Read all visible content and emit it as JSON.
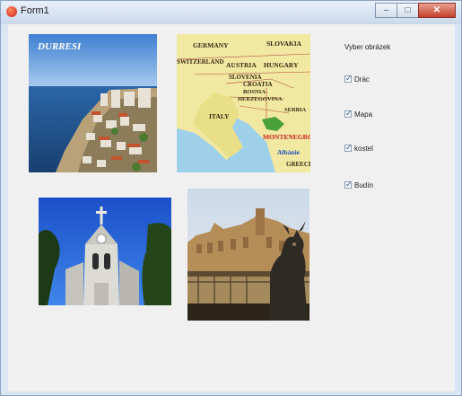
{
  "window": {
    "title": "Form1"
  },
  "caption_buttons": {
    "minimize": "–",
    "maximize": "□",
    "close": "✕"
  },
  "images": {
    "durresi": {
      "caption": "DURRESI"
    },
    "mapa": {
      "labels": [
        "GERMANY",
        "SLOVAKIA",
        "SWITZERLAND",
        "AUSTRIA",
        "HUNGARY",
        "SLOVENIA",
        "CROATIA",
        "BOSNIA-",
        "HERZEGOVINA",
        "ITALY",
        "SERBIA",
        "MONTENEGRO",
        "Albánie",
        "GREECE"
      ]
    }
  },
  "panel": {
    "prompt": "Vyber obrázek",
    "options": [
      {
        "label": "Drác",
        "checked": true
      },
      {
        "label": "Mapa",
        "checked": true
      },
      {
        "label": "kostel",
        "checked": true
      },
      {
        "label": "Budín",
        "checked": true
      }
    ]
  }
}
